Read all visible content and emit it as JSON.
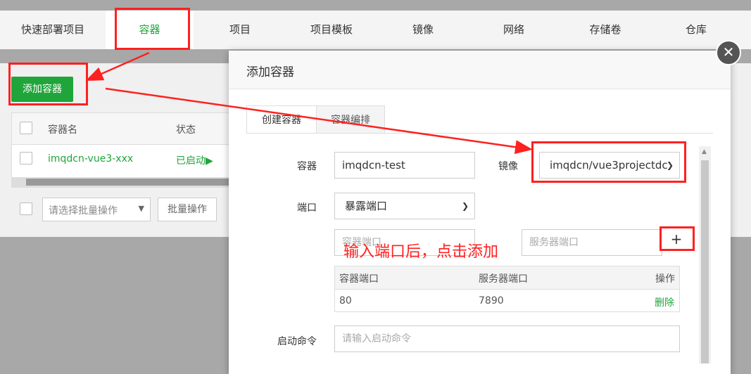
{
  "top_tabs": [
    "快速部署项目",
    "容器",
    "项目",
    "项目模板",
    "镜像",
    "网络",
    "存储卷",
    "仓库"
  ],
  "active_tab": "容器",
  "add_container_button": "添加容器",
  "container_table": {
    "columns": [
      "容器名",
      "状态"
    ],
    "rows": [
      {
        "name": "imqdcn-vue3-xxx",
        "status": "已启动▶"
      }
    ]
  },
  "batch": {
    "select_placeholder": "请选择批量操作",
    "button": "批量操作"
  },
  "modal": {
    "title": "添加容器",
    "close_icon": "close-icon",
    "tabs": [
      "创建容器",
      "容器编排"
    ],
    "form": {
      "container_label": "容器",
      "container_value": "imqdcn-test",
      "image_label": "镜像",
      "image_value": "imqdcn/vue3projectdc",
      "port_label": "端口",
      "port_mode": "暴露端口",
      "container_port_placeholder": "容器端口",
      "server_port_placeholder": "服务器端口",
      "add_port_symbol": "+",
      "port_table": {
        "headers": [
          "容器端口",
          "服务器端口",
          "操作"
        ],
        "rows": [
          {
            "container_port": "80",
            "server_port": "7890",
            "action": "删除"
          }
        ]
      },
      "command_label": "启动命令",
      "command_placeholder": "请输入启动命令"
    }
  },
  "annotation_text": "输入端口后，点击添加",
  "colors": {
    "accent_green": "#20a53a",
    "annotation_red": "#ff2020"
  }
}
